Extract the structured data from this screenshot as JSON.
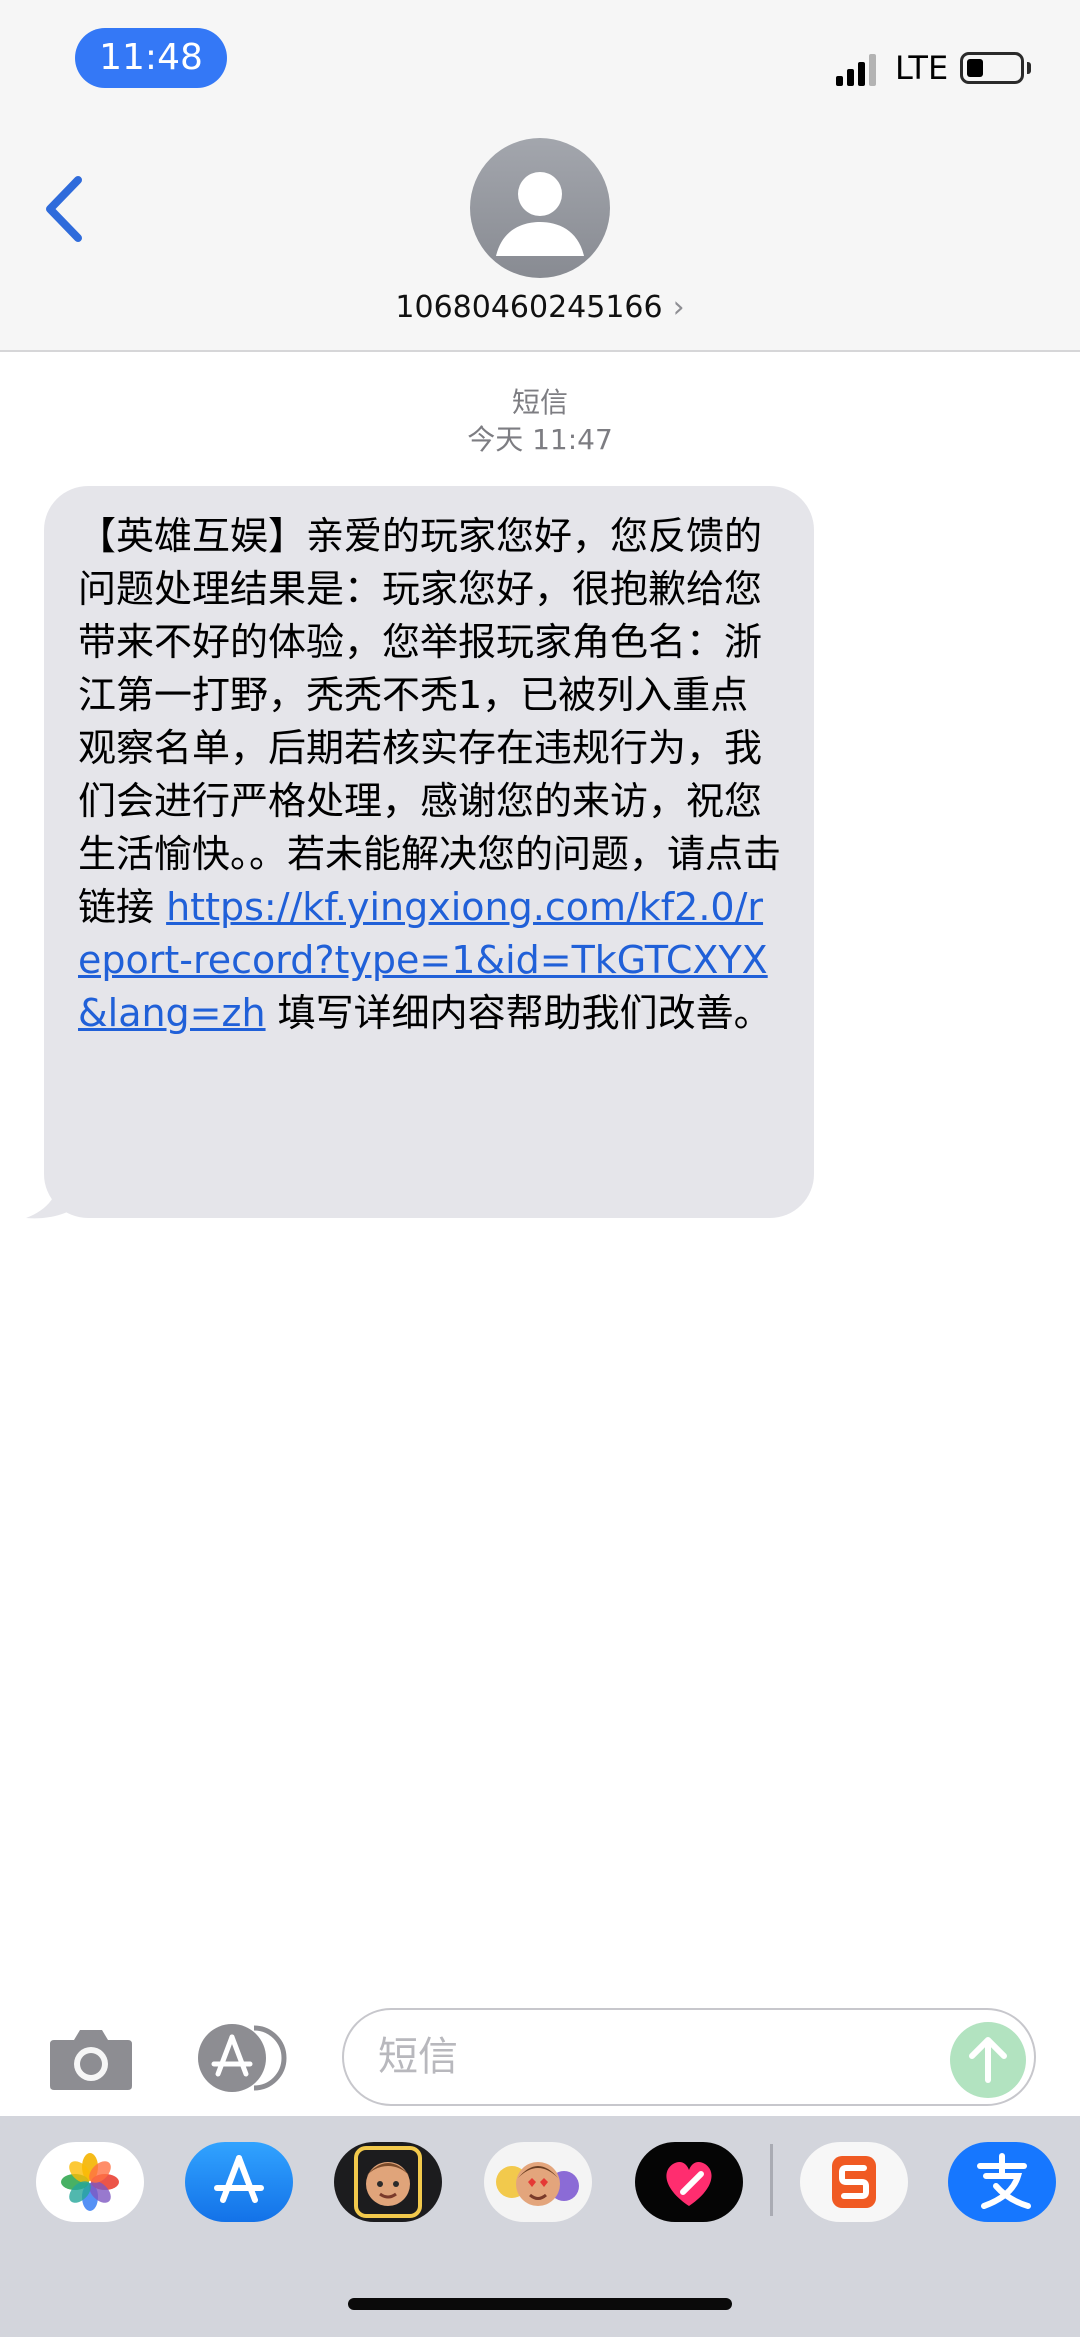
{
  "status_bar": {
    "time": "11:48",
    "network": "LTE"
  },
  "header": {
    "contact": "10680460245166",
    "chevron": "›"
  },
  "conversation": {
    "service": "短信",
    "timestamp": "今天 11:47",
    "message": {
      "text_before_link": "【英雄互娱】亲爱的玩家您好，您反馈的问题处理结果是：玩家您好，很抱歉给您带来不好的体验，您举报玩家角色名：浙江第一打野，秃秃不秃1，已被列入重点观察名单，后期若核实存在违规行为，我们会进行严格处理，感谢您的来访，祝您生活愉快。。若未能解决您的问题，请点击链接 ",
      "link": "https://kf.yingxiong.com/kf2.0/report-record?type=1&id=TkGTCXYX&lang=zh",
      "text_after_link": " 填写详细内容帮助我们改善。"
    }
  },
  "input": {
    "placeholder": "短信"
  },
  "colors": {
    "accent": "#3478f6",
    "bubble": "#e5e5ea",
    "link": "#2060d8",
    "send": "#b2e3c0"
  },
  "icons": [
    "back-chevron-icon",
    "contact-avatar-icon",
    "camera-icon",
    "app-store-icon",
    "send-arrow-icon",
    "photos-app-icon",
    "app-store-app-icon",
    "memoji-app-icon",
    "memoji-stickers-app-icon",
    "digital-touch-app-icon",
    "sogou-app-icon",
    "alipay-app-icon"
  ]
}
